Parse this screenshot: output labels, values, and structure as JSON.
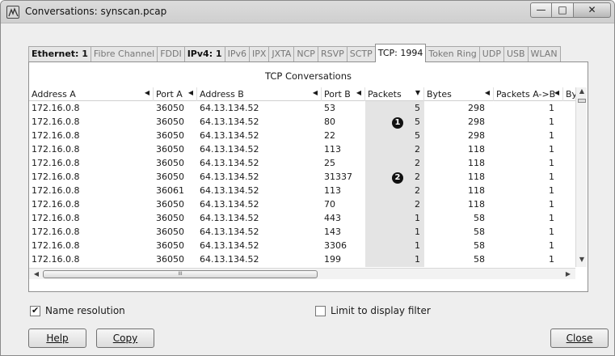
{
  "window": {
    "title": "Conversations: synscan.pcap",
    "minimize_glyph": "—",
    "maximize_glyph": "□",
    "close_glyph": "✕"
  },
  "tabs": [
    {
      "label": "Ethernet: 1"
    },
    {
      "label": "Fibre Channel"
    },
    {
      "label": "FDDI"
    },
    {
      "label": "IPv4: 1"
    },
    {
      "label": "IPv6"
    },
    {
      "label": "IPX"
    },
    {
      "label": "JXTA"
    },
    {
      "label": "NCP"
    },
    {
      "label": "RSVP"
    },
    {
      "label": "SCTP"
    },
    {
      "label": "TCP: 1994"
    },
    {
      "label": "Token Ring"
    },
    {
      "label": "UDP"
    },
    {
      "label": "USB"
    },
    {
      "label": "WLAN"
    }
  ],
  "panel_title": "TCP Conversations",
  "columns": {
    "address_a": "Address A",
    "port_a": "Port A",
    "address_b": "Address B",
    "port_b": "Port B",
    "packets": "Packets",
    "bytes": "Bytes",
    "packets_ab": "Packets A->B",
    "bytes_ab": "Byt"
  },
  "sort_arrow": "▼",
  "col_arrow": "◀",
  "rows": [
    {
      "address_a": "172.16.0.8",
      "port_a": "36050",
      "address_b": "64.13.134.52",
      "port_b": "53",
      "packets": "5",
      "bytes": "298",
      "packets_ab": "1"
    },
    {
      "address_a": "172.16.0.8",
      "port_a": "36050",
      "address_b": "64.13.134.52",
      "port_b": "80",
      "packets": "5",
      "bytes": "298",
      "packets_ab": "1",
      "marker": "1"
    },
    {
      "address_a": "172.16.0.8",
      "port_a": "36050",
      "address_b": "64.13.134.52",
      "port_b": "22",
      "packets": "5",
      "bytes": "298",
      "packets_ab": "1"
    },
    {
      "address_a": "172.16.0.8",
      "port_a": "36050",
      "address_b": "64.13.134.52",
      "port_b": "113",
      "packets": "2",
      "bytes": "118",
      "packets_ab": "1"
    },
    {
      "address_a": "172.16.0.8",
      "port_a": "36050",
      "address_b": "64.13.134.52",
      "port_b": "25",
      "packets": "2",
      "bytes": "118",
      "packets_ab": "1"
    },
    {
      "address_a": "172.16.0.8",
      "port_a": "36050",
      "address_b": "64.13.134.52",
      "port_b": "31337",
      "packets": "2",
      "bytes": "118",
      "packets_ab": "1",
      "marker": "2"
    },
    {
      "address_a": "172.16.0.8",
      "port_a": "36061",
      "address_b": "64.13.134.52",
      "port_b": "113",
      "packets": "2",
      "bytes": "118",
      "packets_ab": "1"
    },
    {
      "address_a": "172.16.0.8",
      "port_a": "36050",
      "address_b": "64.13.134.52",
      "port_b": "70",
      "packets": "2",
      "bytes": "118",
      "packets_ab": "1"
    },
    {
      "address_a": "172.16.0.8",
      "port_a": "36050",
      "address_b": "64.13.134.52",
      "port_b": "443",
      "packets": "1",
      "bytes": "58",
      "packets_ab": "1"
    },
    {
      "address_a": "172.16.0.8",
      "port_a": "36050",
      "address_b": "64.13.134.52",
      "port_b": "143",
      "packets": "1",
      "bytes": "58",
      "packets_ab": "1"
    },
    {
      "address_a": "172.16.0.8",
      "port_a": "36050",
      "address_b": "64.13.134.52",
      "port_b": "3306",
      "packets": "1",
      "bytes": "58",
      "packets_ab": "1"
    },
    {
      "address_a": "172.16.0.8",
      "port_a": "36050",
      "address_b": "64.13.134.52",
      "port_b": "199",
      "packets": "1",
      "bytes": "58",
      "packets_ab": "1"
    }
  ],
  "scrollbar": {
    "up": "▲",
    "down": "▼",
    "left": "◀",
    "right": "▶",
    "grip": "III"
  },
  "options": {
    "name_resolution": "Name resolution",
    "name_resolution_checked": true,
    "limit_filter": "Limit to display filter",
    "limit_filter_checked": false,
    "check_glyph": "✔"
  },
  "buttons": {
    "help": "Help",
    "copy": "Copy",
    "close": "Close"
  }
}
